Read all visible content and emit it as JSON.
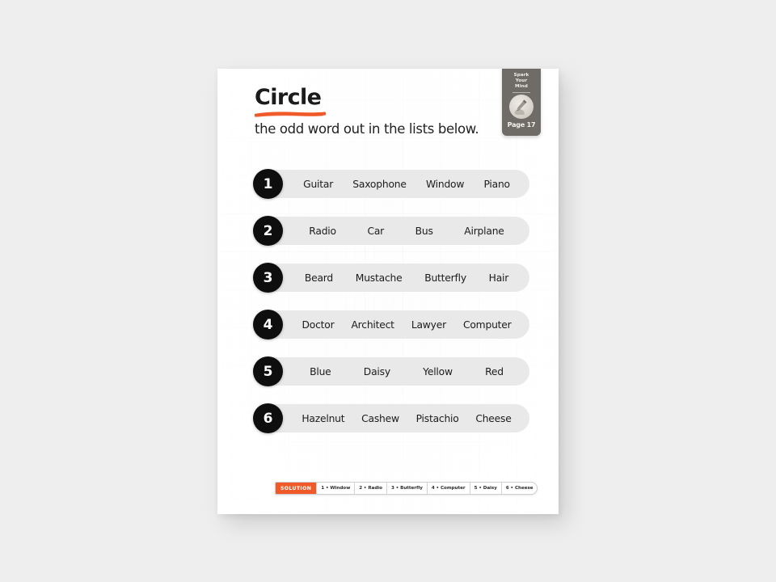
{
  "colors": {
    "accent": "#ef5a28",
    "annotation": "#e8502a",
    "page_bg": "#fdfdfd",
    "canvas_bg": "#eeeeee",
    "pill_bg": "#e9e9e9",
    "badge_bg": "#0e0e0e",
    "tab_bg": "#6f6c68"
  },
  "header": {
    "title": "Circle",
    "subtitle": "the odd word out in the lists below."
  },
  "corner_tab": {
    "kicker_line1": "Spark",
    "kicker_line2": "Your",
    "kicker_line3": "Mind",
    "illustration_icon": "hand-with-pencil-icon",
    "page_label": "Page 17"
  },
  "rows": [
    {
      "number": "1",
      "words": [
        "Guitar",
        "Saxophone",
        "Window",
        "Piano"
      ],
      "circled": "Window"
    },
    {
      "number": "2",
      "words": [
        "Radio",
        "Car",
        "Bus",
        "Airplane"
      ],
      "circled": null
    },
    {
      "number": "3",
      "words": [
        "Beard",
        "Mustache",
        "Butterfly",
        "Hair"
      ],
      "circled": null
    },
    {
      "number": "4",
      "words": [
        "Doctor",
        "Architect",
        "Lawyer",
        "Computer"
      ],
      "circled": null
    },
    {
      "number": "5",
      "words": [
        "Blue",
        "Daisy",
        "Yellow",
        "Red"
      ],
      "circled": null
    },
    {
      "number": "6",
      "words": [
        "Hazelnut",
        "Cashew",
        "Pistachio",
        "Cheese"
      ],
      "circled": null
    }
  ],
  "solution": {
    "label": "SOLUTION",
    "items": [
      "1 • Window",
      "2 • Radio",
      "3 • Butterfly",
      "4 • Computer",
      "5 • Daisy",
      "6 • Cheese"
    ]
  }
}
